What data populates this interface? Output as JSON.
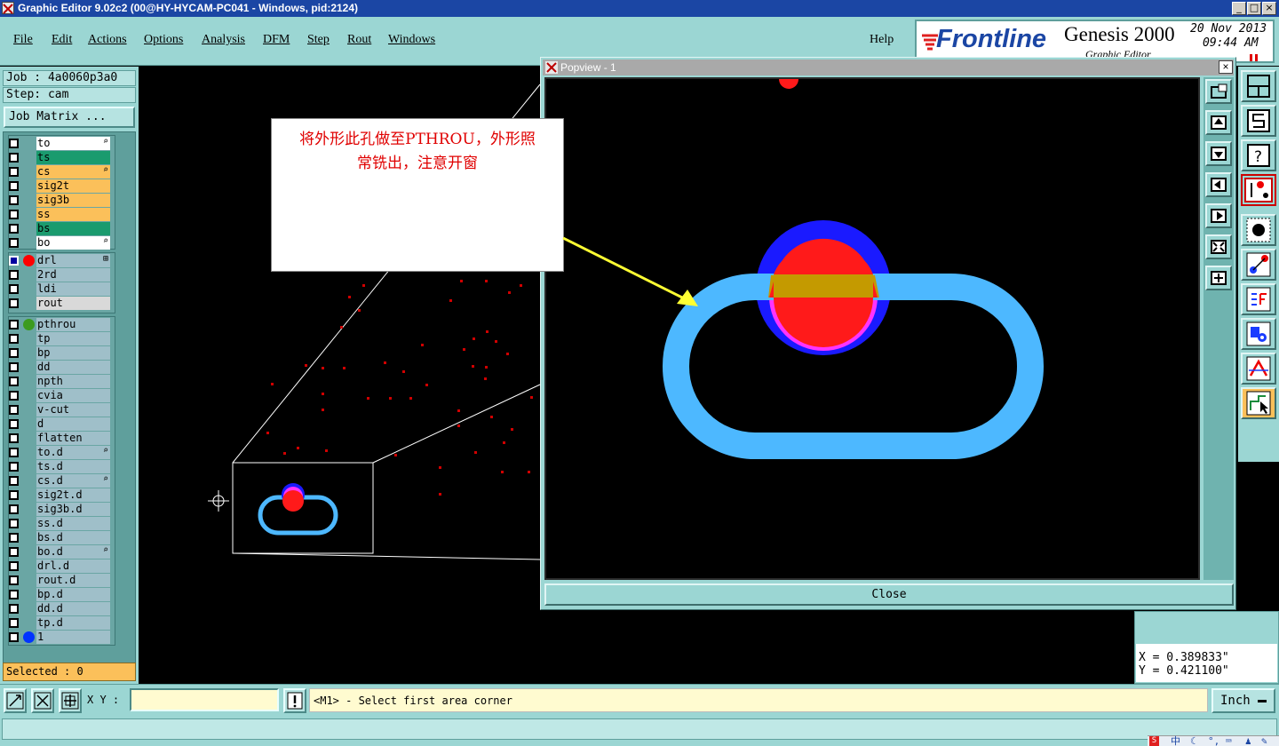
{
  "window": {
    "title": "Graphic Editor 9.02c2 (00@HY-HYCAM-PC041 - Windows, pid:2124)"
  },
  "menu": {
    "items": [
      "File",
      "Edit",
      "Actions",
      "Options",
      "Analysis",
      "DFM",
      "Step",
      "Rout",
      "Windows"
    ],
    "help": "Help"
  },
  "brand": {
    "logo_text": "Frontline",
    "product": "Genesis 2000",
    "subtitle": "Graphic Editor",
    "date": "20 Nov 2013",
    "time": "09:44 AM"
  },
  "job": {
    "job_label": "Job : 4a0060p3a0",
    "step_label": "Step: cam",
    "matrix_button": "Job Matrix ..."
  },
  "layer_groups": [
    {
      "layers": [
        {
          "name": "to",
          "color": "#ffffff",
          "mark": "⌕"
        },
        {
          "name": "ts",
          "color": "#1a9b6e",
          "mark": ""
        },
        {
          "name": "cs",
          "color": "#fbc05a",
          "mark": "⌕"
        },
        {
          "name": "sig2t",
          "color": "#fbc05a",
          "mark": ""
        },
        {
          "name": "sig3b",
          "color": "#fbc05a",
          "mark": ""
        },
        {
          "name": "ss",
          "color": "#fbc05a",
          "mark": ""
        },
        {
          "name": "bs",
          "color": "#1a9b6e",
          "mark": ""
        },
        {
          "name": "bo",
          "color": "#ffffff",
          "mark": "⌕"
        }
      ]
    },
    {
      "layers": [
        {
          "name": "drl",
          "color": "#9fbfc9",
          "mark": "⊞",
          "dot": "#ff0000",
          "checked_color": "#0000a0"
        },
        {
          "name": "2rd",
          "color": "#9fbfc9",
          "mark": ""
        },
        {
          "name": "ldi",
          "color": "#9fbfc9",
          "mark": ""
        },
        {
          "name": "rout",
          "color": "#d9d9d9",
          "mark": ""
        }
      ]
    },
    {
      "layers": [
        {
          "name": "pthrou",
          "color": "#9fbfc9",
          "mark": "",
          "dot": "#3c9b1f"
        },
        {
          "name": "tp",
          "color": "#9fbfc9",
          "mark": ""
        },
        {
          "name": "bp",
          "color": "#9fbfc9",
          "mark": ""
        },
        {
          "name": "dd",
          "color": "#9fbfc9",
          "mark": ""
        },
        {
          "name": "npth",
          "color": "#9fbfc9",
          "mark": ""
        },
        {
          "name": "cvia",
          "color": "#9fbfc9",
          "mark": ""
        },
        {
          "name": "v-cut",
          "color": "#9fbfc9",
          "mark": ""
        },
        {
          "name": "d",
          "color": "#9fbfc9",
          "mark": ""
        },
        {
          "name": "flatten",
          "color": "#9fbfc9",
          "mark": ""
        },
        {
          "name": "to.d",
          "color": "#9fbfc9",
          "mark": "⌕"
        },
        {
          "name": "ts.d",
          "color": "#9fbfc9",
          "mark": ""
        },
        {
          "name": "cs.d",
          "color": "#9fbfc9",
          "mark": "⌕"
        },
        {
          "name": "sig2t.d",
          "color": "#9fbfc9",
          "mark": ""
        },
        {
          "name": "sig3b.d",
          "color": "#9fbfc9",
          "mark": ""
        },
        {
          "name": "ss.d",
          "color": "#9fbfc9",
          "mark": ""
        },
        {
          "name": "bs.d",
          "color": "#9fbfc9",
          "mark": ""
        },
        {
          "name": "bo.d",
          "color": "#9fbfc9",
          "mark": "⌕"
        },
        {
          "name": "drl.d",
          "color": "#9fbfc9",
          "mark": ""
        },
        {
          "name": "rout.d",
          "color": "#9fbfc9",
          "mark": ""
        },
        {
          "name": "bp.d",
          "color": "#9fbfc9",
          "mark": ""
        },
        {
          "name": "dd.d",
          "color": "#9fbfc9",
          "mark": ""
        },
        {
          "name": "tp.d",
          "color": "#9fbfc9",
          "mark": ""
        },
        {
          "name": "1",
          "color": "#9fbfc9",
          "mark": "",
          "dot": "#0033ff"
        }
      ]
    }
  ],
  "selected": {
    "label": "Selected : 0"
  },
  "popview": {
    "title": "Popview - 1",
    "close_label": "Close"
  },
  "note": {
    "line1": "将外形此孔做至PTHROU，外形照",
    "line2": "常铣出，注意开窗"
  },
  "coords": {
    "x": "X = 0.389833\"",
    "y": "Y = 0.421100\""
  },
  "bottom": {
    "xy_label": "X Y :",
    "xy_value": "",
    "prompt": "<M1> - Select first area corner",
    "units": "Inch"
  },
  "tray": {
    "ime_text": "中"
  }
}
